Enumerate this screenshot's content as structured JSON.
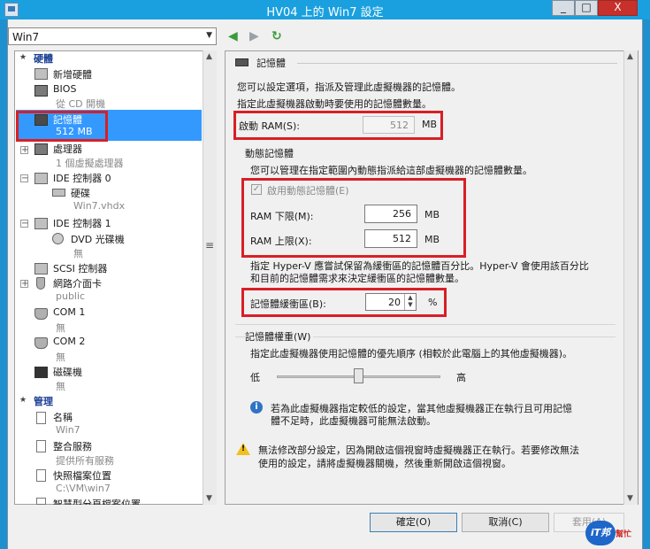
{
  "window": {
    "title": "HV04 上的 Win7 設定",
    "min": "_",
    "max": "□",
    "close": "X"
  },
  "vm_select": {
    "value": "Win7"
  },
  "tree": {
    "hardware_header": "硬體",
    "items": [
      {
        "label": "新增硬體"
      },
      {
        "label": "BIOS",
        "sub": "從 CD 開機"
      },
      {
        "label": "記憶體",
        "sub": "512 MB"
      },
      {
        "label": "處理器",
        "sub": "1 個虛擬處理器"
      },
      {
        "label": "IDE 控制器 0"
      },
      {
        "label": "硬碟",
        "sub": "Win7.vhdx"
      },
      {
        "label": "IDE 控制器 1"
      },
      {
        "label": "DVD 光碟機",
        "sub": "無"
      },
      {
        "label": "SCSI 控制器"
      },
      {
        "label": "網路介面卡",
        "sub": "public"
      },
      {
        "label": "COM 1",
        "sub": "無"
      },
      {
        "label": "COM 2",
        "sub": "無"
      },
      {
        "label": "磁碟機",
        "sub": "無"
      }
    ],
    "management_header": "管理",
    "mgmt": [
      {
        "label": "名稱",
        "sub": "Win7"
      },
      {
        "label": "整合服務",
        "sub": "提供所有服務"
      },
      {
        "label": "快照檔案位置",
        "sub": "C:\\VM\\win7"
      },
      {
        "label": "智慧型分頁檔案位置"
      }
    ]
  },
  "panel": {
    "section_title": "記憶體",
    "desc1": "您可以設定選項，指派及管理此虛擬機器的記憶體。",
    "desc2": "指定此虛擬機器啟動時要使用的記憶體數量。",
    "startup_ram_label": "啟動 RAM(S):",
    "startup_ram_value": "512",
    "unit_mb": "MB",
    "dynamic_title": "動態記憶體",
    "dynamic_desc": "您可以管理在指定範圍內動態指派給這部虛擬機器的記憶體數量。",
    "enable_dynamic_label": "啟用動態記憶體(E)",
    "min_ram_label": "RAM 下限(M):",
    "min_ram_value": "256",
    "max_ram_label": "RAM 上限(X):",
    "max_ram_value": "512",
    "buffer_desc1": "指定 Hyper-V 應嘗試保留為緩衝區的記憶體百分比。Hyper-V 會使用該百分比",
    "buffer_desc2": "和目前的記憶體需求來決定緩衝區的記憶體數量。",
    "buffer_label": "記憶體緩衝區(B):",
    "buffer_value": "20",
    "percent": "%",
    "weight_title": "記憶體權重(W)",
    "weight_desc": "指定此虛擬機器使用記憶體的優先順序 (相較於此電腦上的其他虛擬機器)。",
    "low": "低",
    "high": "高",
    "weight_level": 0.5,
    "info1": "若為此虛擬機器指定較低的設定，當其他虛擬機器正在執行且可用記憶",
    "info2": "體不足時，此虛擬機器可能無法啟動。",
    "warn1": "無法修改部分設定，因為開啟這個視窗時虛擬機器正在執行。若要修改無法",
    "warn2": "使用的設定，請將虛擬機器關機，然後重新開啟這個視窗。"
  },
  "buttons": {
    "ok": "確定(O)",
    "cancel": "取消(C)",
    "apply": "套用(A)"
  },
  "logo": {
    "text": "iT邦",
    "sub": "幫忙"
  }
}
